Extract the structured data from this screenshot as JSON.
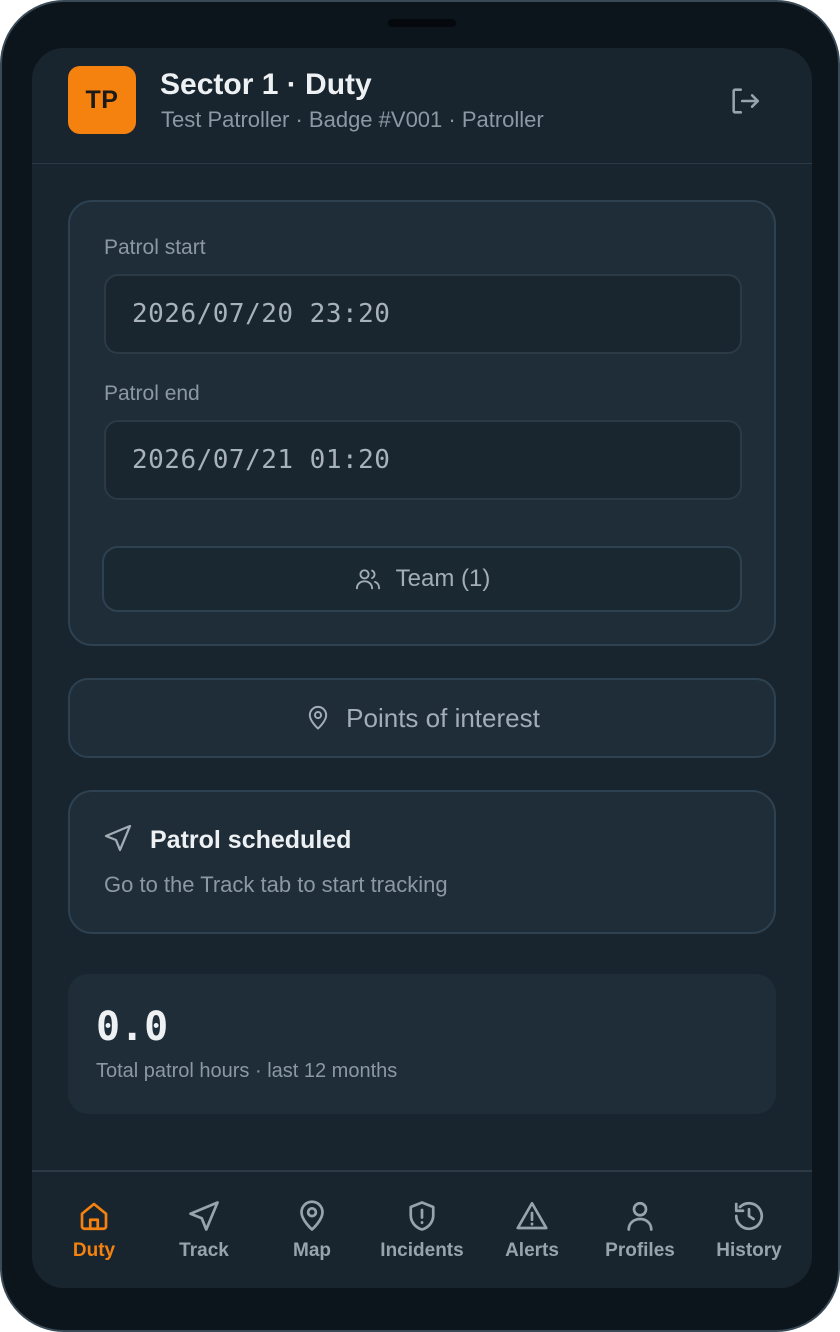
{
  "header": {
    "avatar_initials": "TP",
    "title": "Sector 1 · Duty",
    "subtitle": "Test Patroller · Badge #V001 · Patroller",
    "logout_icon": "logout-icon"
  },
  "patrol": {
    "start_label": "Patrol start",
    "start_value": "2026/07/20 23:20",
    "end_label": "Patrol end",
    "end_value": "2026/07/21 01:20",
    "team_label": "Team (1)"
  },
  "poi": {
    "label": "Points of interest"
  },
  "schedule": {
    "title": "Patrol scheduled",
    "subtitle": "Go to the Track tab to start tracking"
  },
  "stats": {
    "value": "0.0",
    "label": "Total patrol hours · last 12 months"
  },
  "nav": {
    "items": [
      {
        "label": "Duty",
        "icon": "home-icon",
        "active": true
      },
      {
        "label": "Track",
        "icon": "navigation-icon"
      },
      {
        "label": "Map",
        "icon": "map-pin-icon"
      },
      {
        "label": "Incidents",
        "icon": "shield-alert-icon"
      },
      {
        "label": "Alerts",
        "icon": "warning-triangle-icon"
      },
      {
        "label": "Profiles",
        "icon": "user-icon"
      },
      {
        "label": "History",
        "icon": "history-icon"
      }
    ]
  },
  "colors": {
    "accent": "#f5820f",
    "background": "#18252e",
    "panel": "#1e2d38"
  }
}
